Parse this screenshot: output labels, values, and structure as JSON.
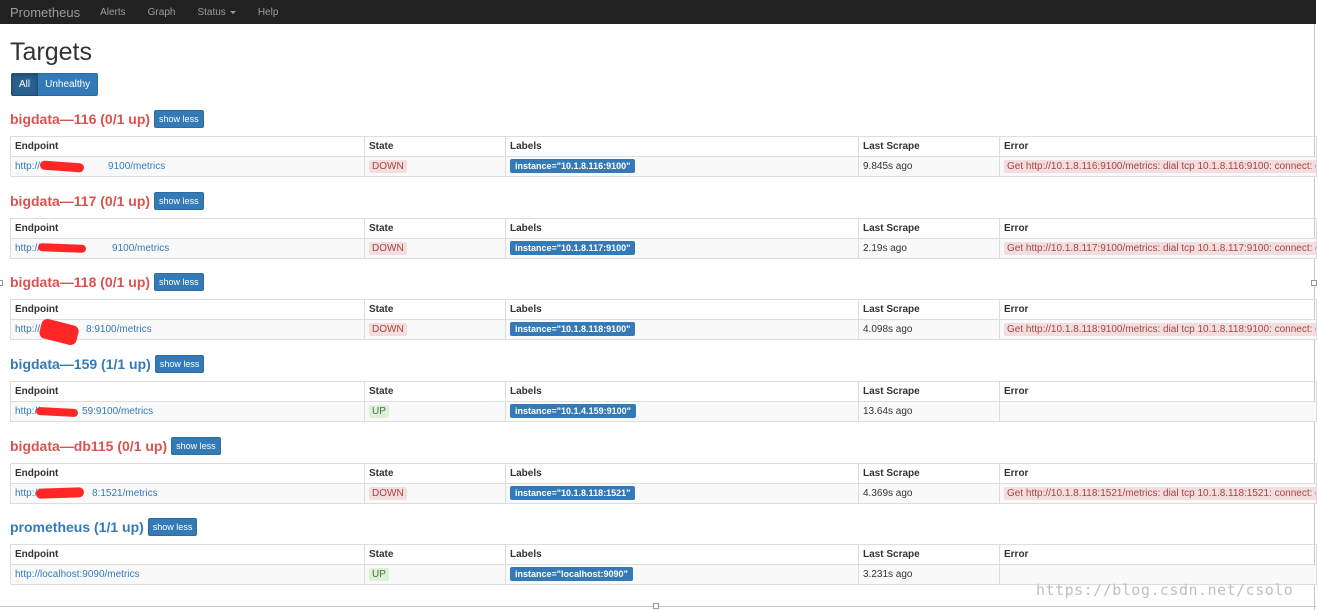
{
  "navbar": {
    "brand": "Prometheus",
    "items": [
      {
        "label": "Alerts"
      },
      {
        "label": "Graph"
      },
      {
        "label": "Status"
      },
      {
        "label": "Help"
      }
    ]
  },
  "page": {
    "title": "Targets",
    "filters": {
      "all": "All",
      "unhealthy": "Unhealthy"
    }
  },
  "columns": {
    "endpoint": "Endpoint",
    "state": "State",
    "labels": "Labels",
    "last_scrape": "Last Scrape",
    "error": "Error"
  },
  "jobs": [
    {
      "title": "bigdata—116 (0/1 up)",
      "health": "danger",
      "button": "show less",
      "target": {
        "endpoint": "http:// ‍ ‍ ‍ ‍ ‍ ‍ ‍ ‍ ‍ ‍ ‍ ‍ 9100/metrics",
        "endpoint_visible": "http://",
        "endpoint_tail": "9100/metrics",
        "state": "DOWN",
        "label": "instance=\"10.1.8.116:9100\"",
        "last_scrape": "9.845s ago",
        "error": "Get http://10.1.8.116:9100/metrics: dial tcp 10.1.8.116:9100: connect: co"
      }
    },
    {
      "title": "bigdata—117 (0/1 up)",
      "health": "danger",
      "button": "show less",
      "target": {
        "endpoint_visible": "http://",
        "endpoint_tail": "9100/metrics",
        "state": "DOWN",
        "label": "instance=\"10.1.8.117:9100\"",
        "last_scrape": "2.19s ago",
        "error": "Get http://10.1.8.117:9100/metrics: dial tcp 10.1.8.117:9100: connect: co"
      }
    },
    {
      "title": "bigdata—118 (0/1 up)",
      "health": "danger",
      "button": "show less",
      "target": {
        "endpoint_visible": "http://",
        "endpoint_tail": "8:9100/metrics",
        "state": "DOWN",
        "label": "instance=\"10.1.8.118:9100\"",
        "last_scrape": "4.098s ago",
        "error": "Get http://10.1.8.118:9100/metrics: dial tcp 10.1.8.118:9100: connect: co"
      }
    },
    {
      "title": "bigdata—159 (1/1 up)",
      "health": "healthy",
      "button": "show less",
      "target": {
        "endpoint_visible": "http://",
        "endpoint_tail": "59:9100/metrics",
        "state": "UP",
        "label": "instance=\"10.1.4.159:9100\"",
        "last_scrape": "13.64s ago",
        "error": ""
      }
    },
    {
      "title": "bigdata—db115 (0/1 up)",
      "health": "danger",
      "button": "show less",
      "target": {
        "endpoint_visible": "http://",
        "endpoint_tail": "8:1521/metrics",
        "state": "DOWN",
        "label": "instance=\"10.1.8.118:1521\"",
        "last_scrape": "4.369s ago",
        "error": "Get http://10.1.8.118:1521/metrics: dial tcp 10.1.8.118:1521: connect: co"
      }
    },
    {
      "title": "prometheus (1/1 up)",
      "health": "healthy",
      "button": "show less",
      "target": {
        "endpoint_visible": "http://localhost:9090/metrics",
        "endpoint_tail": "",
        "state": "UP",
        "label": "instance=\"localhost:9090\"",
        "last_scrape": "3.231s ago",
        "error": ""
      }
    }
  ],
  "watermark": "https://blog.csdn.net/csolo",
  "colors": {
    "navbar": "#222222",
    "primary": "#337ab7",
    "danger": "#d9534f",
    "down_bg": "#f2dede",
    "up_bg": "#dff0d8"
  }
}
